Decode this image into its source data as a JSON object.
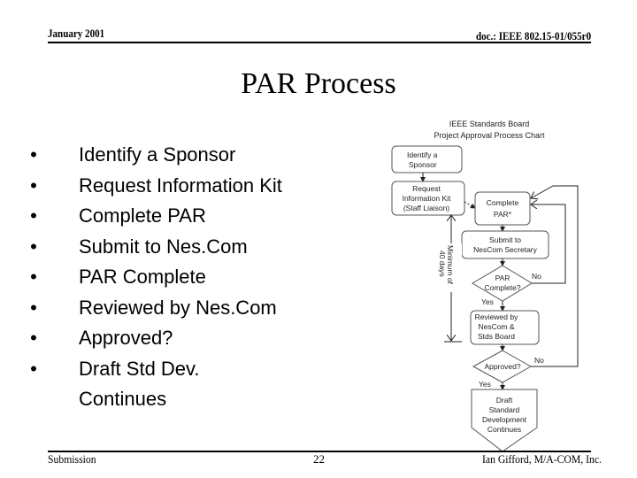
{
  "header": {
    "date": "January 2001",
    "doc_id": "doc.: IEEE 802.15-01/055r0"
  },
  "slide": {
    "title": "PAR Process",
    "bullets": [
      "Identify a Sponsor",
      "Request Information Kit",
      "Complete PAR",
      "Submit to Nes.Com",
      "PAR Complete",
      "Reviewed by Nes.Com",
      "Approved?",
      "Draft Std Dev. Continues"
    ],
    "bullet_glyph": "•"
  },
  "flowchart": {
    "title_line1": "IEEE Standards Board",
    "title_line2": "Project Approval Process Chart",
    "nodes": {
      "identify": [
        "Identify a",
        "Sponsor"
      ],
      "request": [
        "Request",
        "Information Kit",
        "(Staff Liaison)"
      ],
      "complete": [
        "Complete",
        "PAR*"
      ],
      "submit": [
        "Submit to",
        "NesCom Secretary"
      ],
      "par_complete": [
        "PAR",
        "Complete?"
      ],
      "reviewed": [
        "Reviewed by",
        "NesCom &",
        "Stds Board"
      ],
      "approved": [
        "Approved?"
      ],
      "draft": [
        "Draft",
        "Standard",
        "Development",
        "Continues"
      ]
    },
    "labels": {
      "no1": "No",
      "yes1": "Yes",
      "no2": "No",
      "yes2": "Yes",
      "duration_line1": "Minimum of",
      "duration_line2": "40 days"
    }
  },
  "footer": {
    "left": "Submission",
    "page": "22",
    "author": "Ian Gifford, M/A-COM, Inc."
  }
}
